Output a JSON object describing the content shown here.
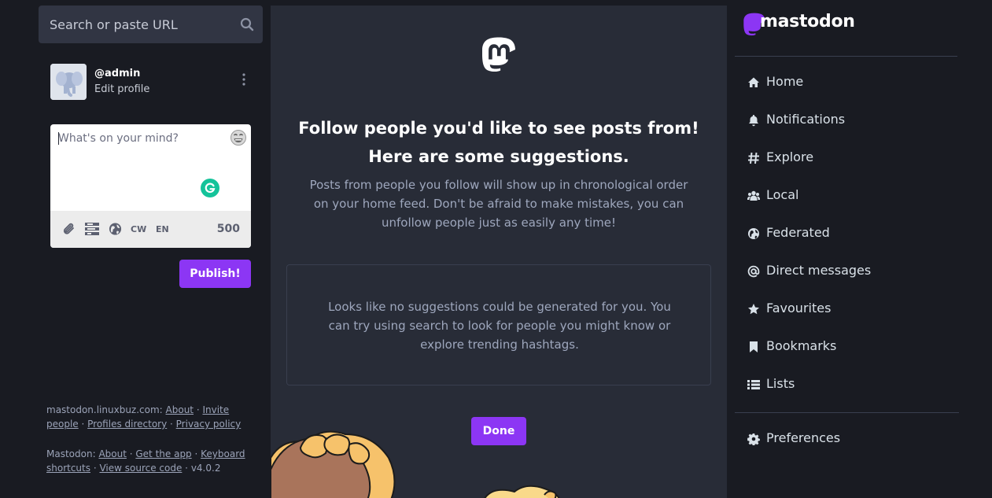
{
  "search": {
    "placeholder": "Search or paste URL",
    "icon": "search-icon"
  },
  "profile": {
    "handle": "@admin",
    "edit_label": "Edit profile"
  },
  "composer": {
    "placeholder": "What's on your mind?",
    "char_count": "500",
    "cw_label": "CW",
    "lang_label": "EN",
    "publish_label": "Publish!"
  },
  "footer": {
    "domain": "mastodon.linuxbuz.com",
    "links1": [
      "About",
      "Invite people",
      "Profiles directory",
      "Privacy policy"
    ],
    "app_name": "Mastodon",
    "links2": [
      "About",
      "Get the app",
      "Keyboard shortcuts",
      "View source code"
    ],
    "version": "v4.0.2"
  },
  "onboarding": {
    "headline_line1": "Follow people you'd like to see posts from!",
    "headline_line2": "Here are some suggestions.",
    "lead": "Posts from people you follow will show up in chronological order on your home feed. Don't be afraid to make mistakes, you can unfollow people just as easily any time!",
    "empty": "Looks like no suggestions could be generated for you. You can try using search to look for people you might know or explore trending hashtags.",
    "done_label": "Done"
  },
  "brand": {
    "name": "mastodon"
  },
  "nav": {
    "items": [
      {
        "label": "Home",
        "icon": "home-icon"
      },
      {
        "label": "Notifications",
        "icon": "bell-icon"
      },
      {
        "label": "Explore",
        "icon": "hashtag-icon"
      },
      {
        "label": "Local",
        "icon": "users-icon"
      },
      {
        "label": "Federated",
        "icon": "globe-icon"
      },
      {
        "label": "Direct messages",
        "icon": "at-icon"
      },
      {
        "label": "Favourites",
        "icon": "star-icon"
      },
      {
        "label": "Bookmarks",
        "icon": "bookmark-icon"
      },
      {
        "label": "Lists",
        "icon": "list-icon"
      },
      {
        "label": "Preferences",
        "icon": "gear-icon"
      }
    ]
  },
  "colors": {
    "accent": "#8c36f4",
    "background": "#191b22",
    "panel": "#282c37"
  }
}
